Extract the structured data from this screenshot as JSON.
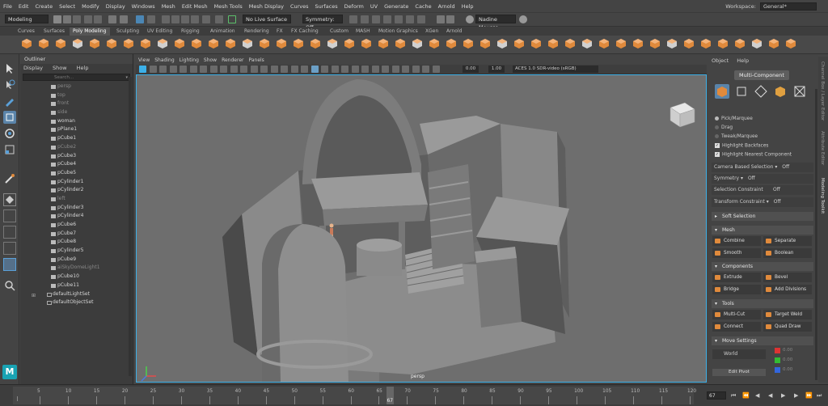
{
  "menubar": {
    "items": [
      "File",
      "Edit",
      "Create",
      "Select",
      "Modify",
      "Display",
      "Windows",
      "Mesh",
      "Edit Mesh",
      "Mesh Tools",
      "Mesh Display",
      "Curves",
      "Surfaces",
      "Deform",
      "UV",
      "Generate",
      "Cache",
      "Arnold",
      "Help"
    ],
    "workspace_label": "Workspace:",
    "workspace_value": "General*"
  },
  "statusline": {
    "mode": "Modeling",
    "live_surface": "No Live Surface",
    "symmetry": "Symmetry: Off",
    "user": "Nadine Moussa"
  },
  "shelf": {
    "tabs": [
      "Curves",
      "Surfaces",
      "Poly Modeling",
      "Sculpting",
      "UV Editing",
      "Rigging",
      "Animation",
      "Rendering",
      "FX",
      "FX Caching",
      "Custom",
      "MASH",
      "Motion Graphics",
      "XGen",
      "Arnold"
    ],
    "active_tab": "Poly Modeling"
  },
  "outliner": {
    "title": "Outliner",
    "menu": [
      "Display",
      "Show",
      "Help"
    ],
    "search_placeholder": "Search...",
    "items": [
      {
        "label": "persp",
        "dim": true
      },
      {
        "label": "top",
        "dim": true
      },
      {
        "label": "front",
        "dim": true
      },
      {
        "label": "side",
        "dim": true
      },
      {
        "label": "woman",
        "dim": false
      },
      {
        "label": "pPlane1",
        "dim": false
      },
      {
        "label": "pCube1",
        "dim": false
      },
      {
        "label": "pCube2",
        "dim": true
      },
      {
        "label": "pCube3",
        "dim": false
      },
      {
        "label": "pCube4",
        "dim": false
      },
      {
        "label": "pCube5",
        "dim": false
      },
      {
        "label": "pCylinder1",
        "dim": false
      },
      {
        "label": "pCylinder2",
        "dim": false
      },
      {
        "label": "left",
        "dim": true
      },
      {
        "label": "pCylinder3",
        "dim": false
      },
      {
        "label": "pCylinder4",
        "dim": false
      },
      {
        "label": "pCube6",
        "dim": false
      },
      {
        "label": "pCube7",
        "dim": false
      },
      {
        "label": "pCube8",
        "dim": false
      },
      {
        "label": "pCylinder5",
        "dim": false
      },
      {
        "label": "pCube9",
        "dim": false
      },
      {
        "label": "aiSkyDomeLight1",
        "dim": true
      },
      {
        "label": "pCube10",
        "dim": false
      },
      {
        "label": "pCube11",
        "dim": false
      }
    ],
    "sets": [
      "defaultLightSet",
      "defaultObjectSet"
    ]
  },
  "viewport": {
    "menu": [
      "View",
      "Shading",
      "Lighting",
      "Show",
      "Renderer",
      "Panels"
    ],
    "exposure": "0.00",
    "gamma": "1.00",
    "color_space": "ACES 1.0 SDR-video (sRGB)",
    "camera_label": "persp"
  },
  "toolkit": {
    "menu": [
      "Object",
      "Help"
    ],
    "multi_component": "Multi-Component",
    "pick_options": [
      "Pick/Marquee",
      "Drag",
      "Tweak/Marquee"
    ],
    "checks": [
      "Highlight Backfaces",
      "Highlight Nearest Component"
    ],
    "camera_based": "Camera Based Selection",
    "camera_based_value": "Off",
    "symmetry": "Symmetry",
    "symmetry_value": "Off",
    "selection_constraint": "Selection Constraint",
    "selection_constraint_value": "Off",
    "transform_constraint": "Transform Constraint",
    "transform_constraint_value": "Off",
    "soft_selection": "Soft Selection",
    "mesh_section": "Mesh",
    "mesh_tools": [
      "Combine",
      "Separate",
      "Smooth",
      "Boolean"
    ],
    "components_section": "Components",
    "component_tools": [
      "Extrude",
      "Bevel",
      "Bridge",
      "Add Divisions"
    ],
    "tools_section": "Tools",
    "tool_tools": [
      "Multi-Cut",
      "Target Weld",
      "Connect",
      "Quad Draw"
    ],
    "move_section": "Move Settings",
    "move_space": "World",
    "axis_values": [
      "0.00",
      "0.00",
      "0.00"
    ],
    "edit_pivot": "Edit Pivot",
    "vertical_tabs": [
      "Channel Box / Layer Editor",
      "Attribute Editor",
      "Modeling Toolkit"
    ]
  },
  "timeline": {
    "labels": [
      "5",
      "10",
      "15",
      "20",
      "25",
      "30",
      "35",
      "40",
      "45",
      "50",
      "55",
      "60",
      "65",
      "70",
      "75",
      "80",
      "85",
      "90",
      "95",
      "100",
      "105",
      "110",
      "115",
      "120"
    ],
    "current_frame": "67",
    "frame_field": "67",
    "start": 1,
    "end": 120
  },
  "colors": {
    "accent_orange": "#e08a3c",
    "viewport_bg": "#6e6e6e",
    "highlight_blue": "#3cb0e8"
  }
}
